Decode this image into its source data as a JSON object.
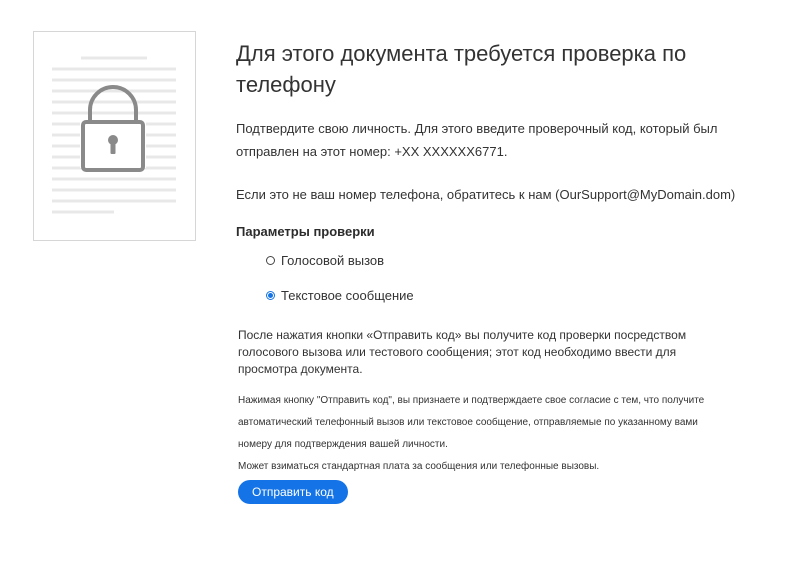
{
  "illustration": {
    "icon": "lock-icon",
    "description_icon": "document-icon"
  },
  "header": {
    "title": "Для этого документа требуется проверка по телефону"
  },
  "body": {
    "identity_text": "Подтвердите свою личность. Для этого введите проверочный код, который был отправлен на этот номер: +XX XXXXXX6771.",
    "contact_text": "Если это не ваш номер телефона, обратитесь к нам (OurSupport@MyDomain.dom)"
  },
  "verification": {
    "heading": "Параметры проверки",
    "options": [
      {
        "label": "Голосовой вызов",
        "selected": false
      },
      {
        "label": "Текстовое сообщение",
        "selected": true
      }
    ]
  },
  "info": {
    "text": "После нажатия кнопки «Отправить код» вы получите код проверки посредством голосового вызова или тестового сообщения; этот код необходимо ввести для просмотра документа."
  },
  "legal": {
    "consent": "Нажимая кнопку \"Отправить код\", вы признаете и подтверждаете свое согласие с тем, что получите автоматический телефонный вызов или текстовое сообщение, отправляемые по указанному вами номеру для подтверждения вашей личности.",
    "fees": "Может взиматься стандартная плата за сообщения или телефонные вызовы."
  },
  "actions": {
    "send_label": "Отправить код"
  },
  "colors": {
    "accent": "#1473e6",
    "text": "#333333",
    "illustration": "#8a8a8a",
    "lines": "#e6e6e6"
  }
}
